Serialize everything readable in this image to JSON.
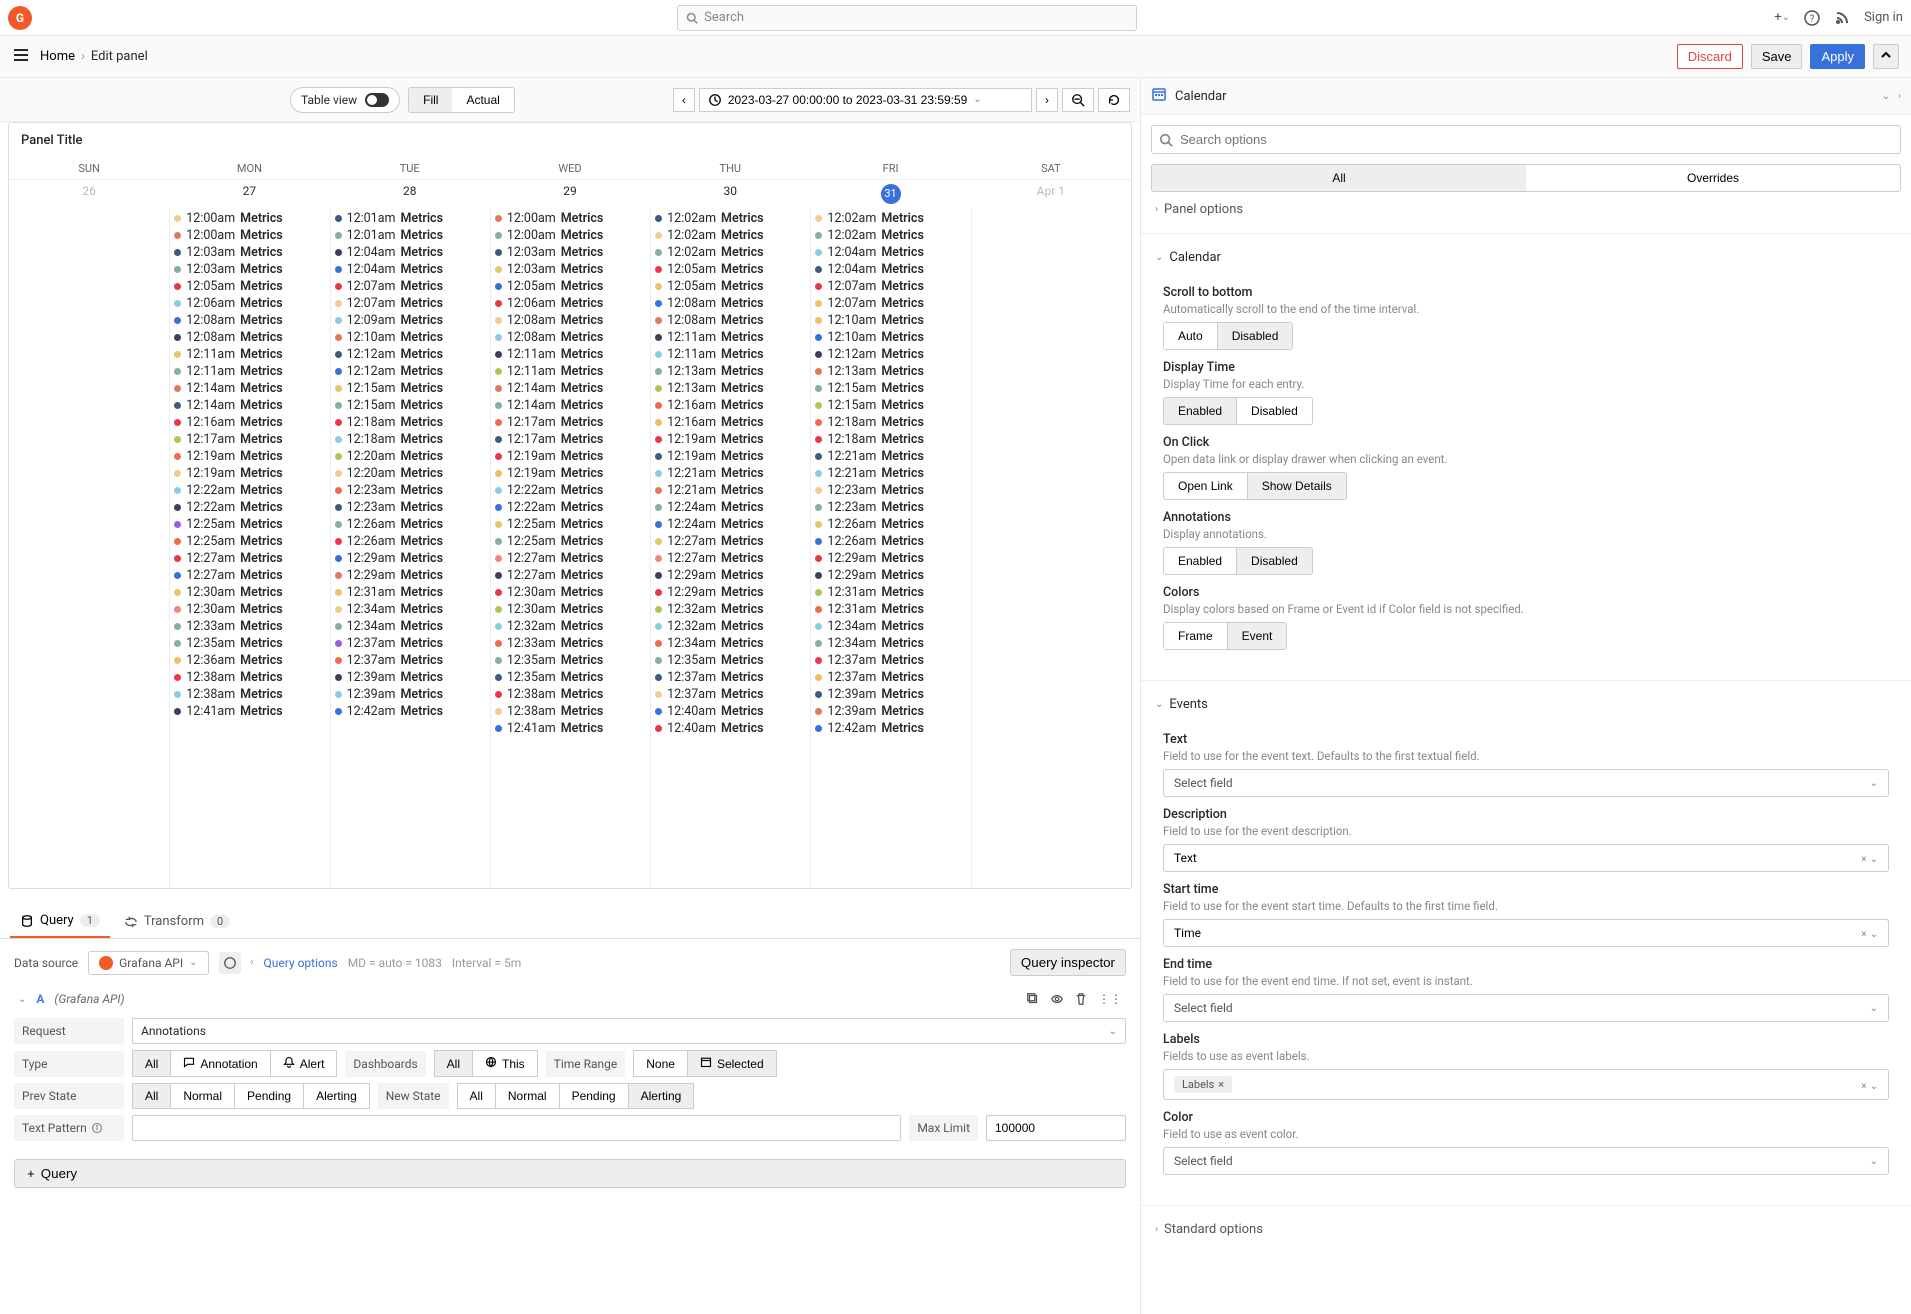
{
  "top": {
    "search_placeholder": "Search",
    "signin": "Sign in"
  },
  "breadcrumb": {
    "home": "Home",
    "edit": "Edit panel"
  },
  "actions": {
    "discard": "Discard",
    "save": "Save",
    "apply": "Apply"
  },
  "toolbar": {
    "table_view": "Table view",
    "fill": "Fill",
    "actual": "Actual",
    "timerange": "2023-03-27 00:00:00 to 2023-03-31 23:59:59"
  },
  "panel": {
    "title": "Panel Title",
    "days": [
      "SUN",
      "MON",
      "TUE",
      "WED",
      "THU",
      "FRI",
      "SAT"
    ],
    "dates": [
      "26",
      "27",
      "28",
      "29",
      "30",
      "31",
      "Apr 1"
    ],
    "today_index": 5,
    "muted_indices": [
      0,
      6
    ],
    "columns": [
      [],
      [
        {
          "t": "12:00am",
          "c": "#f2cc8f"
        },
        {
          "t": "12:00am",
          "c": "#e07a5f"
        },
        {
          "t": "12:03am",
          "c": "#3d5a80"
        },
        {
          "t": "12:03am",
          "c": "#81b29a"
        },
        {
          "t": "12:05am",
          "c": "#e63946"
        },
        {
          "t": "12:06am",
          "c": "#8ecae6"
        },
        {
          "t": "12:08am",
          "c": "#3871dc"
        },
        {
          "t": "12:08am",
          "c": "#3d405b"
        },
        {
          "t": "12:11am",
          "c": "#e9c46a"
        },
        {
          "t": "12:11am",
          "c": "#81b29a"
        },
        {
          "t": "12:14am",
          "c": "#e07a5f"
        },
        {
          "t": "12:14am",
          "c": "#3d5a80"
        },
        {
          "t": "12:16am",
          "c": "#e63946"
        },
        {
          "t": "12:17am",
          "c": "#a7c957"
        },
        {
          "t": "12:19am",
          "c": "#ee6c4d"
        },
        {
          "t": "12:19am",
          "c": "#f2cc8f"
        },
        {
          "t": "12:22am",
          "c": "#8ecae6"
        },
        {
          "t": "12:22am",
          "c": "#3d405b"
        },
        {
          "t": "12:25am",
          "c": "#9b5de5"
        },
        {
          "t": "12:25am",
          "c": "#ee6c4d"
        },
        {
          "t": "12:27am",
          "c": "#e63946"
        },
        {
          "t": "12:27am",
          "c": "#3871dc"
        },
        {
          "t": "12:30am",
          "c": "#e9c46a"
        },
        {
          "t": "12:30am",
          "c": "#f28482"
        },
        {
          "t": "12:33am",
          "c": "#81b29a"
        },
        {
          "t": "12:35am",
          "c": "#81b29a"
        },
        {
          "t": "12:36am",
          "c": "#f6bd60"
        },
        {
          "t": "12:38am",
          "c": "#e63946"
        },
        {
          "t": "12:38am",
          "c": "#8ecae6"
        },
        {
          "t": "12:41am",
          "c": "#3d405b"
        }
      ],
      [
        {
          "t": "12:01am",
          "c": "#3d5a80"
        },
        {
          "t": "12:01am",
          "c": "#81b29a"
        },
        {
          "t": "12:04am",
          "c": "#3d405b"
        },
        {
          "t": "12:04am",
          "c": "#3871dc"
        },
        {
          "t": "12:07am",
          "c": "#e63946"
        },
        {
          "t": "12:07am",
          "c": "#f2cc8f"
        },
        {
          "t": "12:09am",
          "c": "#8ecae6"
        },
        {
          "t": "12:10am",
          "c": "#e07a5f"
        },
        {
          "t": "12:12am",
          "c": "#3d5a80"
        },
        {
          "t": "12:12am",
          "c": "#3871dc"
        },
        {
          "t": "12:15am",
          "c": "#e9c46a"
        },
        {
          "t": "12:15am",
          "c": "#81b29a"
        },
        {
          "t": "12:18am",
          "c": "#e63946"
        },
        {
          "t": "12:18am",
          "c": "#8ecae6"
        },
        {
          "t": "12:20am",
          "c": "#a7c957"
        },
        {
          "t": "12:20am",
          "c": "#f2cc8f"
        },
        {
          "t": "12:23am",
          "c": "#ee6c4d"
        },
        {
          "t": "12:23am",
          "c": "#3d5a80"
        },
        {
          "t": "12:26am",
          "c": "#81b29a"
        },
        {
          "t": "12:26am",
          "c": "#e63946"
        },
        {
          "t": "12:29am",
          "c": "#3871dc"
        },
        {
          "t": "12:29am",
          "c": "#e07a5f"
        },
        {
          "t": "12:31am",
          "c": "#e9c46a"
        },
        {
          "t": "12:34am",
          "c": "#f2cc8f"
        },
        {
          "t": "12:34am",
          "c": "#81b29a"
        },
        {
          "t": "12:37am",
          "c": "#9b5de5"
        },
        {
          "t": "12:37am",
          "c": "#ee6c4d"
        },
        {
          "t": "12:39am",
          "c": "#3d405b"
        },
        {
          "t": "12:39am",
          "c": "#8ecae6"
        },
        {
          "t": "12:42am",
          "c": "#3871dc"
        }
      ],
      [
        {
          "t": "12:00am",
          "c": "#e07a5f"
        },
        {
          "t": "12:00am",
          "c": "#81b29a"
        },
        {
          "t": "12:03am",
          "c": "#3d5a80"
        },
        {
          "t": "12:03am",
          "c": "#e9c46a"
        },
        {
          "t": "12:05am",
          "c": "#3871dc"
        },
        {
          "t": "12:06am",
          "c": "#e63946"
        },
        {
          "t": "12:08am",
          "c": "#f2cc8f"
        },
        {
          "t": "12:08am",
          "c": "#8ecae6"
        },
        {
          "t": "12:11am",
          "c": "#3d405b"
        },
        {
          "t": "12:11am",
          "c": "#a7c957"
        },
        {
          "t": "12:14am",
          "c": "#e07a5f"
        },
        {
          "t": "12:14am",
          "c": "#81b29a"
        },
        {
          "t": "12:17am",
          "c": "#ee6c4d"
        },
        {
          "t": "12:17am",
          "c": "#3d5a80"
        },
        {
          "t": "12:19am",
          "c": "#e63946"
        },
        {
          "t": "12:19am",
          "c": "#f6bd60"
        },
        {
          "t": "12:22am",
          "c": "#8ecae6"
        },
        {
          "t": "12:22am",
          "c": "#3871dc"
        },
        {
          "t": "12:25am",
          "c": "#e9c46a"
        },
        {
          "t": "12:25am",
          "c": "#81b29a"
        },
        {
          "t": "12:27am",
          "c": "#f28482"
        },
        {
          "t": "12:27am",
          "c": "#3d405b"
        },
        {
          "t": "12:30am",
          "c": "#e63946"
        },
        {
          "t": "12:30am",
          "c": "#a7c957"
        },
        {
          "t": "12:32am",
          "c": "#8ecae6"
        },
        {
          "t": "12:33am",
          "c": "#ee6c4d"
        },
        {
          "t": "12:35am",
          "c": "#81b29a"
        },
        {
          "t": "12:35am",
          "c": "#3d5a80"
        },
        {
          "t": "12:38am",
          "c": "#e63946"
        },
        {
          "t": "12:38am",
          "c": "#f2cc8f"
        },
        {
          "t": "12:41am",
          "c": "#3871dc"
        }
      ],
      [
        {
          "t": "12:02am",
          "c": "#3d5a80"
        },
        {
          "t": "12:02am",
          "c": "#f2cc8f"
        },
        {
          "t": "12:02am",
          "c": "#81b29a"
        },
        {
          "t": "12:05am",
          "c": "#e63946"
        },
        {
          "t": "12:05am",
          "c": "#e9c46a"
        },
        {
          "t": "12:08am",
          "c": "#3871dc"
        },
        {
          "t": "12:08am",
          "c": "#e07a5f"
        },
        {
          "t": "12:11am",
          "c": "#3d405b"
        },
        {
          "t": "12:11am",
          "c": "#8ecae6"
        },
        {
          "t": "12:13am",
          "c": "#81b29a"
        },
        {
          "t": "12:13am",
          "c": "#a7c957"
        },
        {
          "t": "12:16am",
          "c": "#ee6c4d"
        },
        {
          "t": "12:16am",
          "c": "#f6bd60"
        },
        {
          "t": "12:19am",
          "c": "#e63946"
        },
        {
          "t": "12:19am",
          "c": "#3d5a80"
        },
        {
          "t": "12:21am",
          "c": "#8ecae6"
        },
        {
          "t": "12:21am",
          "c": "#e07a5f"
        },
        {
          "t": "12:24am",
          "c": "#81b29a"
        },
        {
          "t": "12:24am",
          "c": "#3871dc"
        },
        {
          "t": "12:27am",
          "c": "#e9c46a"
        },
        {
          "t": "12:27am",
          "c": "#f28482"
        },
        {
          "t": "12:29am",
          "c": "#3d405b"
        },
        {
          "t": "12:29am",
          "c": "#e63946"
        },
        {
          "t": "12:32am",
          "c": "#a7c957"
        },
        {
          "t": "12:32am",
          "c": "#8ecae6"
        },
        {
          "t": "12:34am",
          "c": "#ee6c4d"
        },
        {
          "t": "12:35am",
          "c": "#81b29a"
        },
        {
          "t": "12:37am",
          "c": "#3d5a80"
        },
        {
          "t": "12:37am",
          "c": "#f2cc8f"
        },
        {
          "t": "12:40am",
          "c": "#3871dc"
        },
        {
          "t": "12:40am",
          "c": "#e63946"
        }
      ],
      [
        {
          "t": "12:02am",
          "c": "#f2cc8f"
        },
        {
          "t": "12:02am",
          "c": "#81b29a"
        },
        {
          "t": "12:04am",
          "c": "#8ecae6"
        },
        {
          "t": "12:04am",
          "c": "#3d5a80"
        },
        {
          "t": "12:07am",
          "c": "#e63946"
        },
        {
          "t": "12:07am",
          "c": "#e9c46a"
        },
        {
          "t": "12:10am",
          "c": "#f6bd60"
        },
        {
          "t": "12:10am",
          "c": "#3871dc"
        },
        {
          "t": "12:12am",
          "c": "#3d405b"
        },
        {
          "t": "12:13am",
          "c": "#e07a5f"
        },
        {
          "t": "12:15am",
          "c": "#81b29a"
        },
        {
          "t": "12:15am",
          "c": "#a7c957"
        },
        {
          "t": "12:18am",
          "c": "#ee6c4d"
        },
        {
          "t": "12:18am",
          "c": "#e63946"
        },
        {
          "t": "12:21am",
          "c": "#3d5a80"
        },
        {
          "t": "12:21am",
          "c": "#8ecae6"
        },
        {
          "t": "12:23am",
          "c": "#f2cc8f"
        },
        {
          "t": "12:23am",
          "c": "#81b29a"
        },
        {
          "t": "12:26am",
          "c": "#e9c46a"
        },
        {
          "t": "12:26am",
          "c": "#3871dc"
        },
        {
          "t": "12:29am",
          "c": "#e63946"
        },
        {
          "t": "12:29am",
          "c": "#3d405b"
        },
        {
          "t": "12:31am",
          "c": "#a7c957"
        },
        {
          "t": "12:31am",
          "c": "#ee6c4d"
        },
        {
          "t": "12:34am",
          "c": "#8ecae6"
        },
        {
          "t": "12:34am",
          "c": "#81b29a"
        },
        {
          "t": "12:37am",
          "c": "#e63946"
        },
        {
          "t": "12:37am",
          "c": "#f6bd60"
        },
        {
          "t": "12:39am",
          "c": "#3d5a80"
        },
        {
          "t": "12:39am",
          "c": "#e07a5f"
        },
        {
          "t": "12:42am",
          "c": "#3871dc"
        }
      ],
      []
    ],
    "metrics_word": "Metrics"
  },
  "query": {
    "tab_query": "Query",
    "tab_query_count": "1",
    "tab_transform": "Transform",
    "tab_transform_count": "0",
    "datasource_label": "Data source",
    "datasource_value": "Grafana API",
    "query_options": "Query options",
    "md": "MD = auto = 1083",
    "interval": "Interval = 5m",
    "inspector": "Query inspector",
    "letter": "A",
    "ds_in_paren": "(Grafana API)",
    "request_label": "Request",
    "request_value": "Annotations",
    "type_label": "Type",
    "type_opts": [
      "All",
      "Annotation",
      "Alert"
    ],
    "dashboards_label": "Dashboards",
    "dash_opts": [
      "All",
      "This"
    ],
    "timerange_label": "Time Range",
    "tr_opts": [
      "None",
      "Selected"
    ],
    "prevstate_label": "Prev State",
    "newstate_label": "New State",
    "state_opts": [
      "All",
      "Normal",
      "Pending",
      "Alerting"
    ],
    "textpattern_label": "Text Pattern",
    "maxlimit_label": "Max Limit",
    "maxlimit_value": "100000",
    "add_query": "Query"
  },
  "right": {
    "header": "Calendar",
    "search_placeholder": "Search options",
    "tab_all": "All",
    "tab_overrides": "Overrides",
    "panel_options": "Panel options",
    "calendar_section": "Calendar",
    "scroll_title": "Scroll to bottom",
    "scroll_desc": "Automatically scroll to the end of the time interval.",
    "auto": "Auto",
    "disabled": "Disabled",
    "enabled": "Enabled",
    "display_time_title": "Display Time",
    "display_time_desc": "Display Time for each entry.",
    "onclick_title": "On Click",
    "onclick_desc": "Open data link or display drawer when clicking an event.",
    "open_link": "Open Link",
    "show_details": "Show Details",
    "annotations_title": "Annotations",
    "annotations_desc": "Display annotations.",
    "colors_title": "Colors",
    "colors_desc": "Display colors based on Frame or Event id if Color field is not specified.",
    "frame": "Frame",
    "event": "Event",
    "events_section": "Events",
    "text_title": "Text",
    "text_desc": "Field to use for the event text. Defaults to the first textual field.",
    "select_field": "Select field",
    "desc_title": "Description",
    "desc_desc": "Field to use for the event description.",
    "desc_value": "Text",
    "start_title": "Start time",
    "start_desc": "Field to use for the event start time. Defaults to the first time field.",
    "start_value": "Time",
    "end_title": "End time",
    "end_desc": "Field to use for the event end time. If not set, event is instant.",
    "labels_title": "Labels",
    "labels_desc": "Fields to use as event labels.",
    "labels_chip": "Labels",
    "color_title": "Color",
    "color_desc": "Field to use as event color.",
    "std_options": "Standard options"
  }
}
